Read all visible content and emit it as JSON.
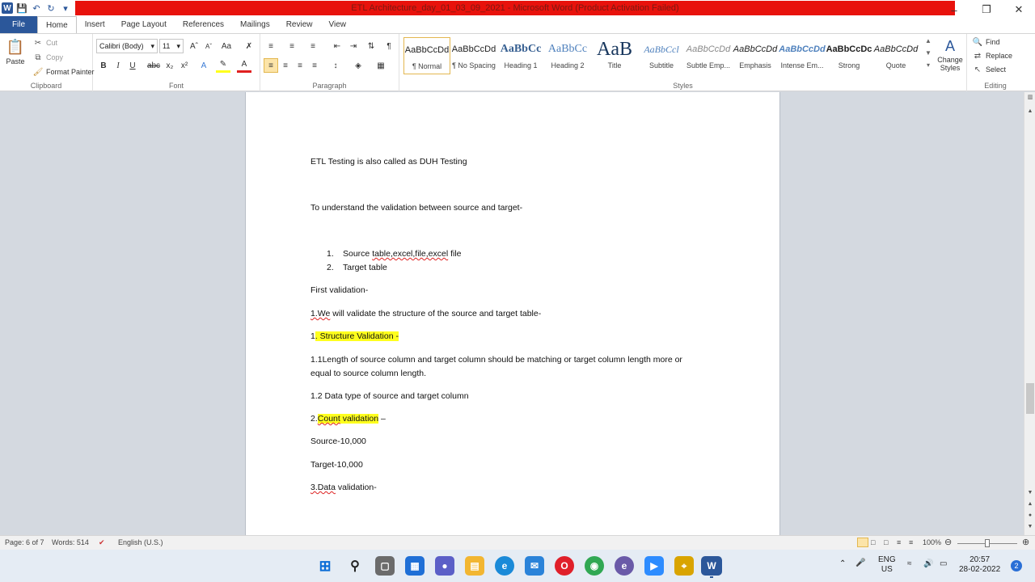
{
  "title_bar": {
    "title": "ETL Architecture_day_01_03_09_2021  -  Microsoft Word (Product Activation Failed)",
    "quick_access": [
      "save-icon",
      "undo-icon",
      "redo-icon"
    ]
  },
  "tabs": [
    "File",
    "Home",
    "Insert",
    "Page Layout",
    "References",
    "Mailings",
    "Review",
    "View"
  ],
  "ribbon": {
    "clipboard": {
      "paste": "Paste",
      "cut": "Cut",
      "copy": "Copy",
      "format_painter": "Format Painter",
      "label": "Clipboard"
    },
    "font": {
      "name": "Calibri (Body)",
      "size": "11",
      "label": "Font"
    },
    "paragraph": {
      "label": "Paragraph"
    },
    "styles": {
      "label": "Styles",
      "items": [
        {
          "preview": "AaBbCcDd",
          "name": "¶ Normal"
        },
        {
          "preview": "AaBbCcDd",
          "name": "¶ No Spacing"
        },
        {
          "preview": "AaBbCc",
          "name": "Heading 1"
        },
        {
          "preview": "AaBbCc",
          "name": "Heading 2"
        },
        {
          "preview": "AaB",
          "name": "Title"
        },
        {
          "preview": "AaBbCcl",
          "name": "Subtitle"
        },
        {
          "preview": "AaBbCcDd",
          "name": "Subtle Emp..."
        },
        {
          "preview": "AaBbCcDd",
          "name": "Emphasis"
        },
        {
          "preview": "AaBbCcDd",
          "name": "Intense Em..."
        },
        {
          "preview": "AaBbCcDc",
          "name": "Strong"
        },
        {
          "preview": "AaBbCcDd",
          "name": "Quote"
        }
      ],
      "change_styles": "Change Styles"
    },
    "editing": {
      "find": "Find",
      "replace": "Replace",
      "select": "Select",
      "label": "Editing"
    }
  },
  "document": {
    "line1": "ETL Testing is also called as DUH Testing",
    "line2": "To understand  the validation between source and target-",
    "list": [
      {
        "num": "1.",
        "text_a": "Source ",
        "text_b": "table,excel,file,excel",
        "text_c": " file"
      },
      {
        "num": "2.",
        "text": "Target table"
      }
    ],
    "first_validation": "First validation-",
    "we_validate_a": "1.We",
    "we_validate_b": " will validate the structure of the source and target table-",
    "structure_validation_a": "1",
    "structure_validation_b": ". Structure  Validation -",
    "length_line1": "1.1Length of source column and target column should be matching or target column length more or",
    "length_line2": "equal to source column length.",
    "datatype": "1.2 Data type  of source and target column",
    "count_a": "2.",
    "count_b": "Count",
    "count_c": " validation",
    "count_d": " –",
    "source_count": "Source-10,000",
    "target_count": "Target-10,000",
    "data_validation_a": "3.Data",
    "data_validation_b": " validation-"
  },
  "status_bar": {
    "page": "Page: 6 of 7",
    "words": "Words: 514",
    "language": "English (U.S.)",
    "zoom": "100%"
  },
  "taskbar": {
    "language": "ENG",
    "region": "US",
    "time": "20:57",
    "date": "28-02-2022",
    "notifications": "2"
  },
  "colors": {
    "accent": "#2b579a",
    "title_red": "#e8120c",
    "highlight": "#ffff1e"
  }
}
